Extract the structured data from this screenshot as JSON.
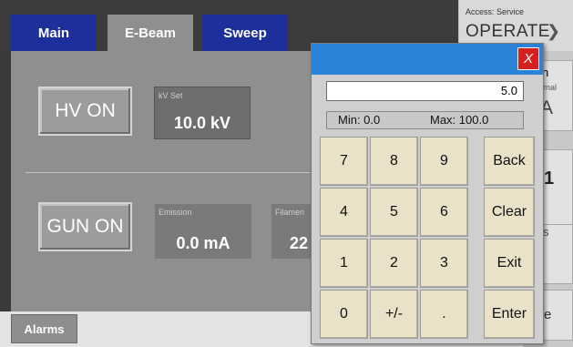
{
  "tabs": [
    {
      "label": "Main"
    },
    {
      "label": "E-Beam"
    },
    {
      "label": "Sweep"
    }
  ],
  "access": {
    "label": "Access: Service",
    "mode": "OPERATE",
    "chevron_icon": "chevron-down-icon"
  },
  "hv": {
    "button": "HV ON",
    "readout_label": "kV Set",
    "readout_value": "10.0 kV"
  },
  "gun": {
    "button": "GUN ON",
    "emission_label": "Emission",
    "emission_value": "0.0 mA",
    "filament_label": "Filamen",
    "filament_value": "22"
  },
  "side_partial": {
    "a": "n",
    "b": "ernal",
    "c": "A",
    "d": "1",
    "e": "s",
    "f": "e"
  },
  "alarms": {
    "label": "Alarms"
  },
  "keypad": {
    "close_label": "X",
    "value": "5.0",
    "min_label": "Min: 0.0",
    "max_label": "Max: 100.0",
    "keys": [
      "7",
      "8",
      "9",
      "4",
      "5",
      "6",
      "1",
      "2",
      "3",
      "0",
      "+/-",
      "."
    ],
    "side_keys": [
      "Back",
      "Clear",
      "Exit",
      "Enter"
    ]
  },
  "colors": {
    "tab_blue": "#1d2f9a",
    "title_blue": "#2b82d9",
    "close_red": "#d52020",
    "key_face": "#e9e2c8"
  }
}
